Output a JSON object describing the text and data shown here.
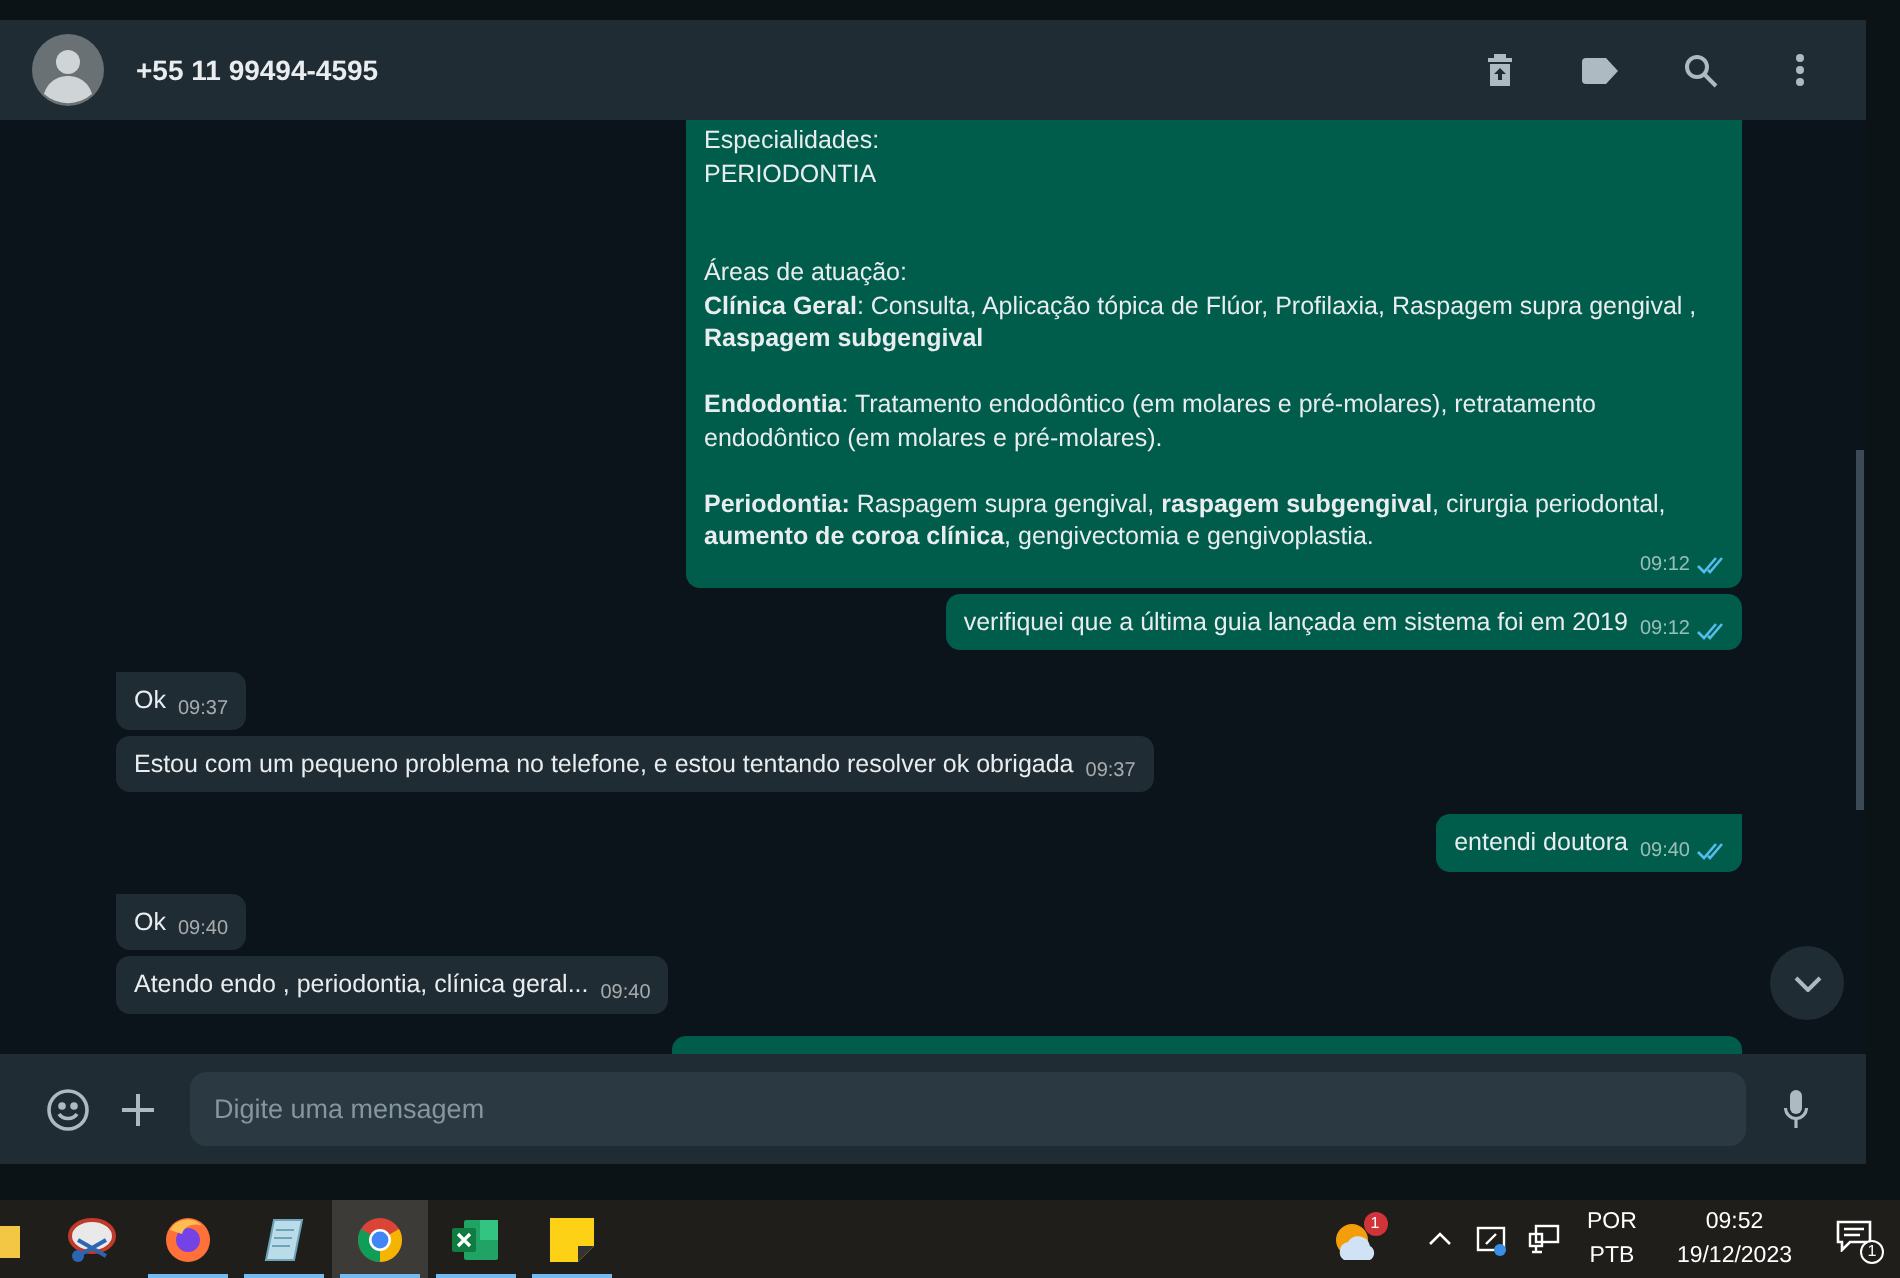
{
  "header": {
    "contact": "+55 11 99494-4595",
    "actions": [
      {
        "kind": "archive"
      },
      {
        "kind": "label"
      },
      {
        "kind": "search"
      },
      {
        "kind": "menu"
      }
    ]
  },
  "messages": [
    {
      "kind": "outgoing",
      "text": "Especialidades:\nPERIODONTIA\n\n\nÁreas de atuação:\n**Clínica Geral**: Consulta, Aplicação tópica de Flúor, Profilaxia, Raspagem supra gengival ,\n**Raspagem subgengival**\n\n**Endodontia**: Tratamento endodôntico (em molares e pré-molares), retratamento endodôntico (em molares e pré-molares).\n\n**Periodontia:** Raspagem supra gengival, **raspagem subgengival**, cirurgia periodontal, **aumento de coroa clínica**, gengivectomia e gengivoplastia.",
      "time": "09:12",
      "read": true,
      "cut_top": true
    },
    {
      "kind": "outgoing",
      "text": "verifiquei que a última guia lançada em sistema foi em 2019",
      "time": "09:12",
      "read": true
    },
    {
      "kind": "incoming",
      "text": "Ok",
      "time": "09:37"
    },
    {
      "kind": "incoming",
      "text": "Estou com um pequeno problema no telefone, e estou tentando resolver ok obrigada",
      "time": "09:37"
    },
    {
      "kind": "outgoing",
      "text": "entendi doutora",
      "time": "09:40",
      "read": true
    },
    {
      "kind": "incoming",
      "text": "Ok",
      "time": "09:40"
    },
    {
      "kind": "incoming",
      "text": "Atendo endo , periodontia, clínica geral...",
      "time": "09:40"
    },
    {
      "kind": "stub"
    }
  ],
  "composer": {
    "placeholder": "Digite uma mensagem"
  },
  "taskbar": {
    "apps": [
      {
        "kind": "folder",
        "running": false,
        "active": false
      },
      {
        "kind": "snip",
        "running": false,
        "active": false
      },
      {
        "kind": "firefox",
        "running": true,
        "active": false
      },
      {
        "kind": "notepad",
        "running": true,
        "active": false
      },
      {
        "kind": "chrome",
        "running": true,
        "active": true
      },
      {
        "kind": "excel",
        "running": true,
        "active": false
      },
      {
        "kind": "sticky",
        "running": true,
        "active": false
      }
    ],
    "weather_badge": "1",
    "language": "POR",
    "layout": "PTB",
    "time": "09:52",
    "date": "19/12/2023",
    "notifications": "1"
  }
}
